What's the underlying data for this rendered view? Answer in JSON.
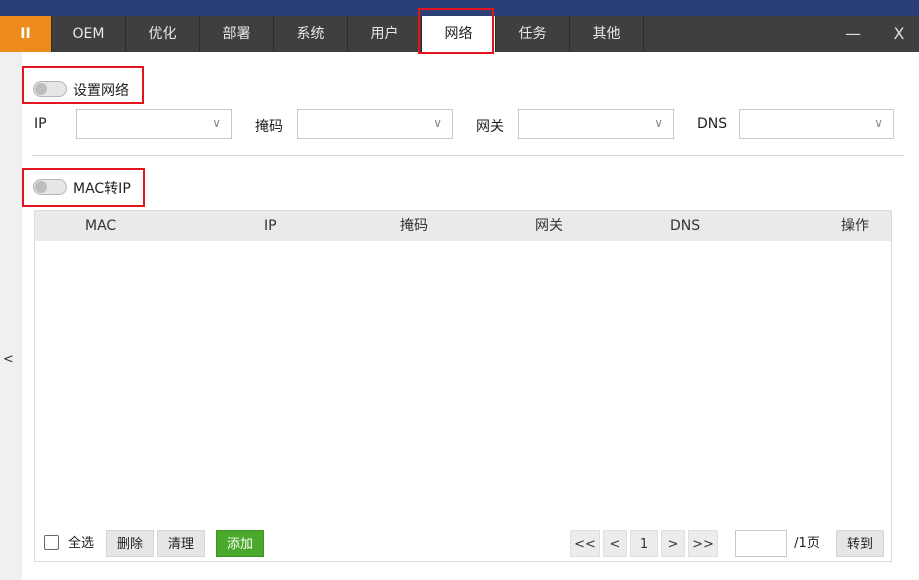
{
  "tabs": [
    {
      "label": "II",
      "brand": true
    },
    {
      "label": "OEM"
    },
    {
      "label": "优化"
    },
    {
      "label": "部署"
    },
    {
      "label": "系统"
    },
    {
      "label": "用户"
    },
    {
      "label": "网络",
      "active": true
    },
    {
      "label": "任务"
    },
    {
      "label": "其他"
    }
  ],
  "window_controls": {
    "minimize": "—",
    "close": "X"
  },
  "sidebar": {
    "collapse": "<"
  },
  "network": {
    "toggle_label": "设置网络",
    "toggle_on": false,
    "fields": [
      {
        "label": "IP",
        "value": ""
      },
      {
        "label": "掩码",
        "value": ""
      },
      {
        "label": "网关",
        "value": ""
      },
      {
        "label": "DNS",
        "value": ""
      }
    ],
    "chevron": "∨"
  },
  "mac": {
    "toggle_label": "MAC转IP",
    "toggle_on": false,
    "columns": [
      "MAC",
      "IP",
      "掩码",
      "网关",
      "DNS",
      "操作"
    ],
    "rows": []
  },
  "footer": {
    "select_all": "全选",
    "delete": "删除",
    "clear": "清理",
    "add": "添加",
    "first": "<<",
    "prev": "<",
    "page": "1",
    "next": ">",
    "last": ">>",
    "goto_value": "",
    "total_pages": "/1页",
    "goto": "转到"
  },
  "colors": {
    "accent": "#ee8b1d",
    "add_button": "#4aa82a",
    "highlight": "#e2151c",
    "tabbar": "#3f3f3f"
  }
}
